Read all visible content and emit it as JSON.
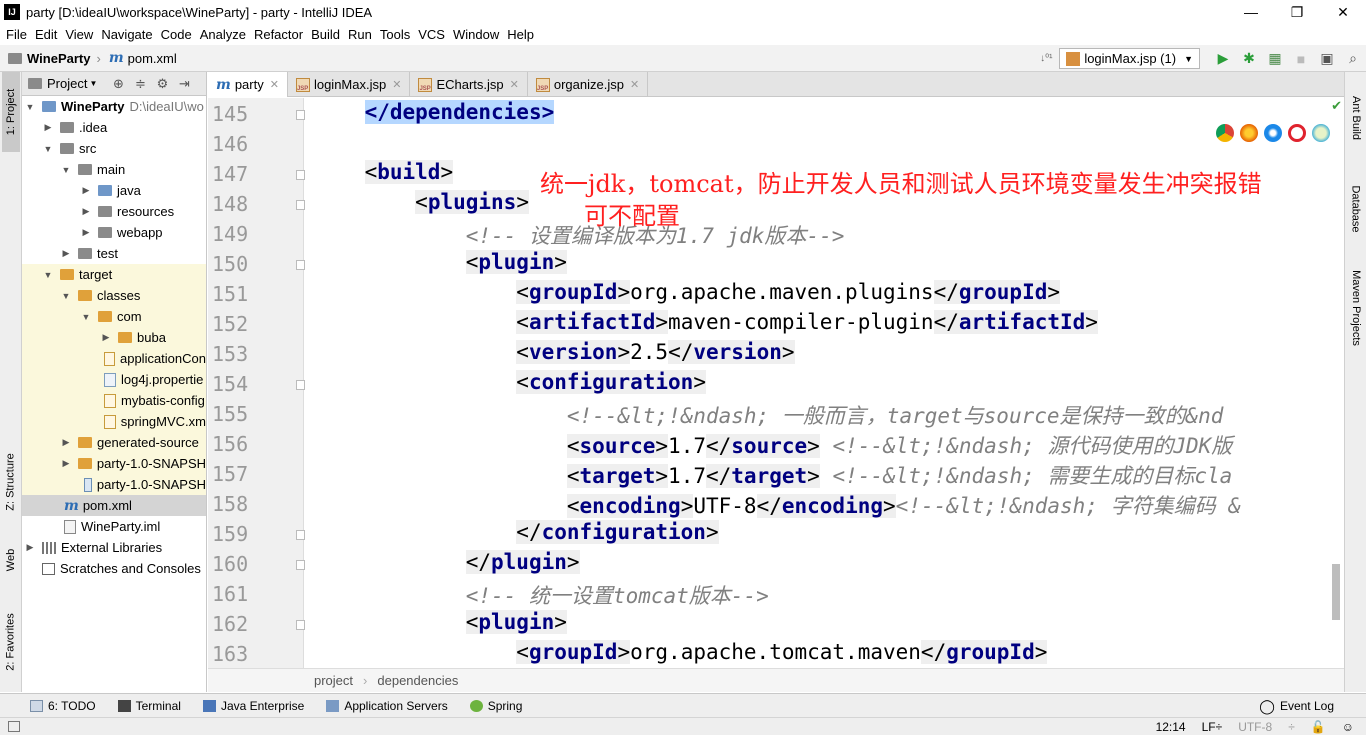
{
  "window": {
    "title": "party [D:\\ideaIU\\workspace\\WineParty] - party - IntelliJ IDEA",
    "app_icon": "IJ",
    "controls": [
      "—",
      "❐",
      "✕"
    ]
  },
  "menu": [
    "File",
    "Edit",
    "View",
    "Navigate",
    "Code",
    "Analyze",
    "Refactor",
    "Build",
    "Run",
    "Tools",
    "VCS",
    "Window",
    "Help"
  ],
  "navbar": {
    "crumbs": [
      {
        "label": "WineParty",
        "icon": "folder-icon"
      },
      {
        "label": "pom.xml",
        "icon": "maven-icon"
      }
    ],
    "run_config": "loginMax.jsp (1)"
  },
  "left_strip": {
    "project": "1: Project",
    "structure": "Z: Structure",
    "web": "Web",
    "favorites": "2: Favorites"
  },
  "right_strip": {
    "ant": "Ant Build",
    "database": "Database",
    "maven": "Maven Projects"
  },
  "project_panel": {
    "header": "Project",
    "tree": [
      {
        "label": "WineParty",
        "extra": "D:\\ideaIU\\wo",
        "bold": true
      },
      {
        "label": ".idea"
      },
      {
        "label": "src"
      },
      {
        "label": "main"
      },
      {
        "label": "java"
      },
      {
        "label": "resources"
      },
      {
        "label": "webapp"
      },
      {
        "label": "test"
      },
      {
        "label": "target"
      },
      {
        "label": "classes"
      },
      {
        "label": "com"
      },
      {
        "label": "buba"
      },
      {
        "label": "applicationCon"
      },
      {
        "label": "log4j.propertie"
      },
      {
        "label": "mybatis-config"
      },
      {
        "label": "springMVC.xm"
      },
      {
        "label": "generated-source"
      },
      {
        "label": "party-1.0-SNAPSH"
      },
      {
        "label": "party-1.0-SNAPSH"
      },
      {
        "label": "pom.xml"
      },
      {
        "label": "WineParty.iml"
      },
      {
        "label": "External Libraries"
      },
      {
        "label": "Scratches and Consoles"
      }
    ]
  },
  "tabs": [
    {
      "label": "party",
      "icon": "maven-icon"
    },
    {
      "label": "loginMax.jsp",
      "icon": "jsp-icon"
    },
    {
      "label": "ECharts.jsp",
      "icon": "jsp-icon"
    },
    {
      "label": "organize.jsp",
      "icon": "jsp-icon"
    }
  ],
  "editor": {
    "line_numbers": [
      "145",
      "146",
      "147",
      "148",
      "149",
      "150",
      "151",
      "152",
      "153",
      "154",
      "155",
      "156",
      "157",
      "158",
      "159",
      "160",
      "161",
      "162",
      "163"
    ],
    "lines": {
      "l145_close": "</dependencies>",
      "l147": "build",
      "l148": "plugins",
      "l149": "<!-- 设置编译版本为1.7 jdk版本-->",
      "l150": "plugin",
      "l151_tag": "groupId",
      "l151_val": "org.apache.maven.plugins",
      "l152_tag": "artifactId",
      "l152_val": "maven-compiler-plugin",
      "l153_tag": "version",
      "l153_val": "2.5",
      "l154": "configuration",
      "l155": "<!--&lt;!&ndash; 一般而言，target与source是保持一致的&nd",
      "l156_tag": "source",
      "l156_val": "1.7",
      "l156_cmt": " <!--&lt;!&ndash; 源代码使用的JDK版",
      "l157_tag": "target",
      "l157_val": "1.7",
      "l157_cmt": " <!--&lt;!&ndash; 需要生成的目标cla",
      "l158_tag": "encoding",
      "l158_val": "UTF-8",
      "l158_cmt": "<!--&lt;!&ndash; 字符集编码 &",
      "l159": "configuration",
      "l160": "plugin",
      "l161": "<!-- 统一设置tomcat版本-->",
      "l162": "plugin",
      "l163_tag": "groupId",
      "l163_val": "org.apache.tomcat.maven"
    },
    "annotation_line1": "统一jdk，tomcat，防止开发人员和测试人员环境变量发生冲突报错",
    "annotation_line2": "可不配置",
    "breadcrumb": [
      "project",
      "dependencies"
    ]
  },
  "bottom_tools": [
    "6: TODO",
    "Terminal",
    "Java Enterprise",
    "Application Servers",
    "Spring"
  ],
  "event_log": "Event Log",
  "status": {
    "position": "12:14",
    "line_sep": "LF÷",
    "encoding": "UTF-8"
  },
  "colors": {
    "tag": "#000080",
    "comment": "#808080",
    "annotation": "#ff2020",
    "run": "#2b9e3a"
  }
}
